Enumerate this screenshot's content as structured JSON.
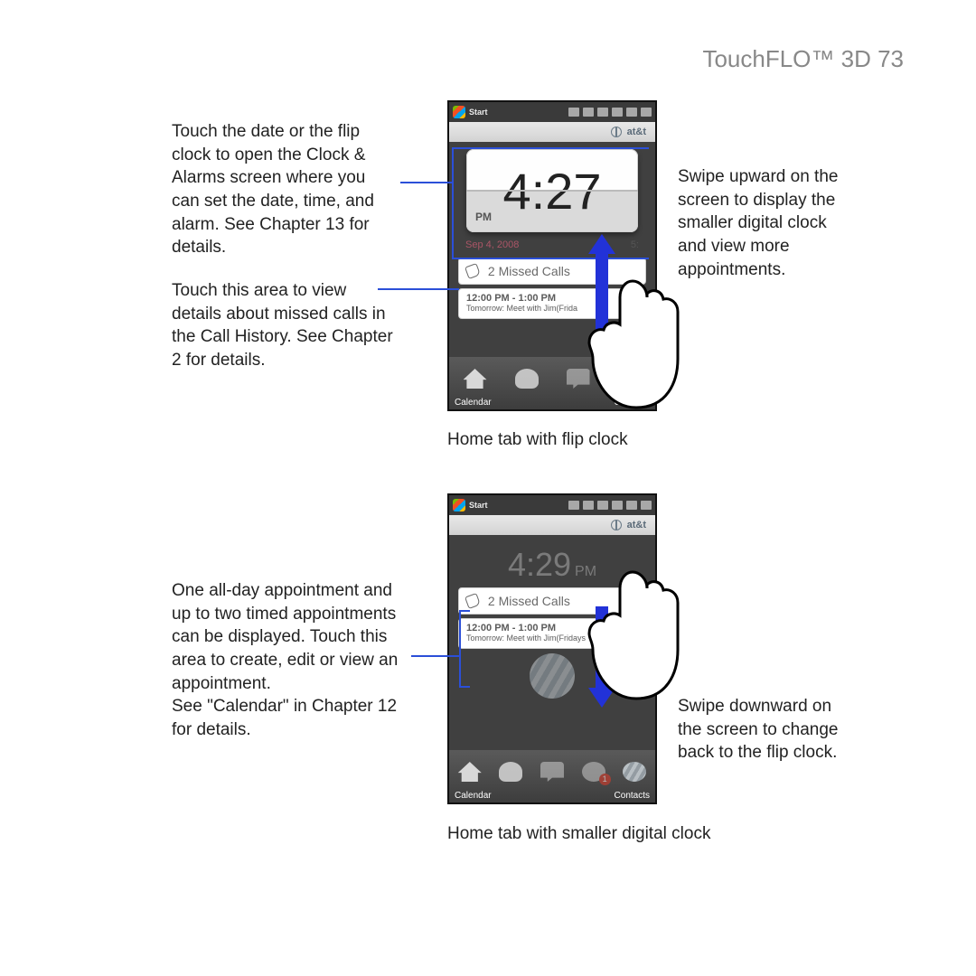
{
  "header": {
    "title": "TouchFLO™ 3D  73"
  },
  "left": {
    "block1": "Touch the date or the flip clock to open the Clock & Alarms screen where you can set the date, time, and alarm. See Chapter 13 for details.",
    "block2": "Touch this area to view details about missed calls in the Call History. See Chapter 2 for details.",
    "block3": "One all-day appointment and up to two timed appointments can be displayed. Touch this area to create, edit or view an appointment.\nSee \"Calendar\" in Chapter 12 for details."
  },
  "right": {
    "block1": "Swipe upward on the screen to display the smaller digital clock and view more appointments.",
    "block2": "Swipe downward on the screen to change back to the flip clock."
  },
  "captions": {
    "c1": "Home tab with flip clock",
    "c2": "Home tab with smaller digital clock"
  },
  "phone": {
    "start": "Start",
    "carrier": "at&t",
    "flip_time": "4:27",
    "flip_pm": "PM",
    "date_left": "Sep 4, 2008",
    "date_right": "5:   ",
    "missed": "2 Missed Calls",
    "appt_time": "12:00 PM - 1:00 PM",
    "appt_desc1": "Tomorrow: Meet with Jim(Frida",
    "appt_desc2": "Tomorrow: Meet with Jim(Fridays",
    "dig_time": "4:29",
    "dig_pm": "PM",
    "badge": "1",
    "dock_left": "Calendar",
    "dock_right": "Contacts"
  }
}
